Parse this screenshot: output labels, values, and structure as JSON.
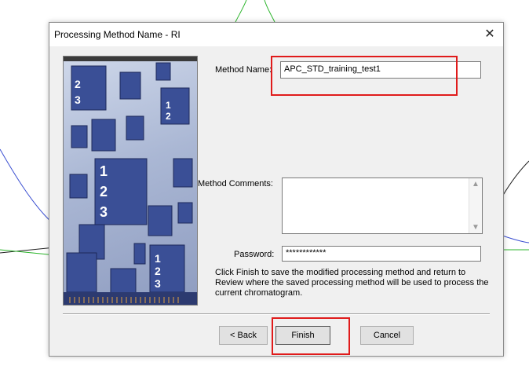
{
  "dialog": {
    "title": "Processing Method Name - RI",
    "close_glyph": "✕",
    "method_name_label": "Method Name:",
    "method_name_value": "APC_STD_training_test1",
    "method_comments_label": "Method Comments:",
    "method_comments_value": "",
    "password_label": "Password:",
    "password_value": "************",
    "description": "Click Finish to save the modified processing method and return to Review where the saved processing method will be used to process the current chromatogram.",
    "buttons": {
      "back": "< Back",
      "finish": "Finish",
      "cancel": "Cancel"
    }
  },
  "side_art_digits": [
    "1",
    "2",
    "3"
  ],
  "colors": {
    "highlight": "#e01b1b",
    "dialog_bg": "#f0f0f0",
    "art_tile": "#3a4f96"
  }
}
